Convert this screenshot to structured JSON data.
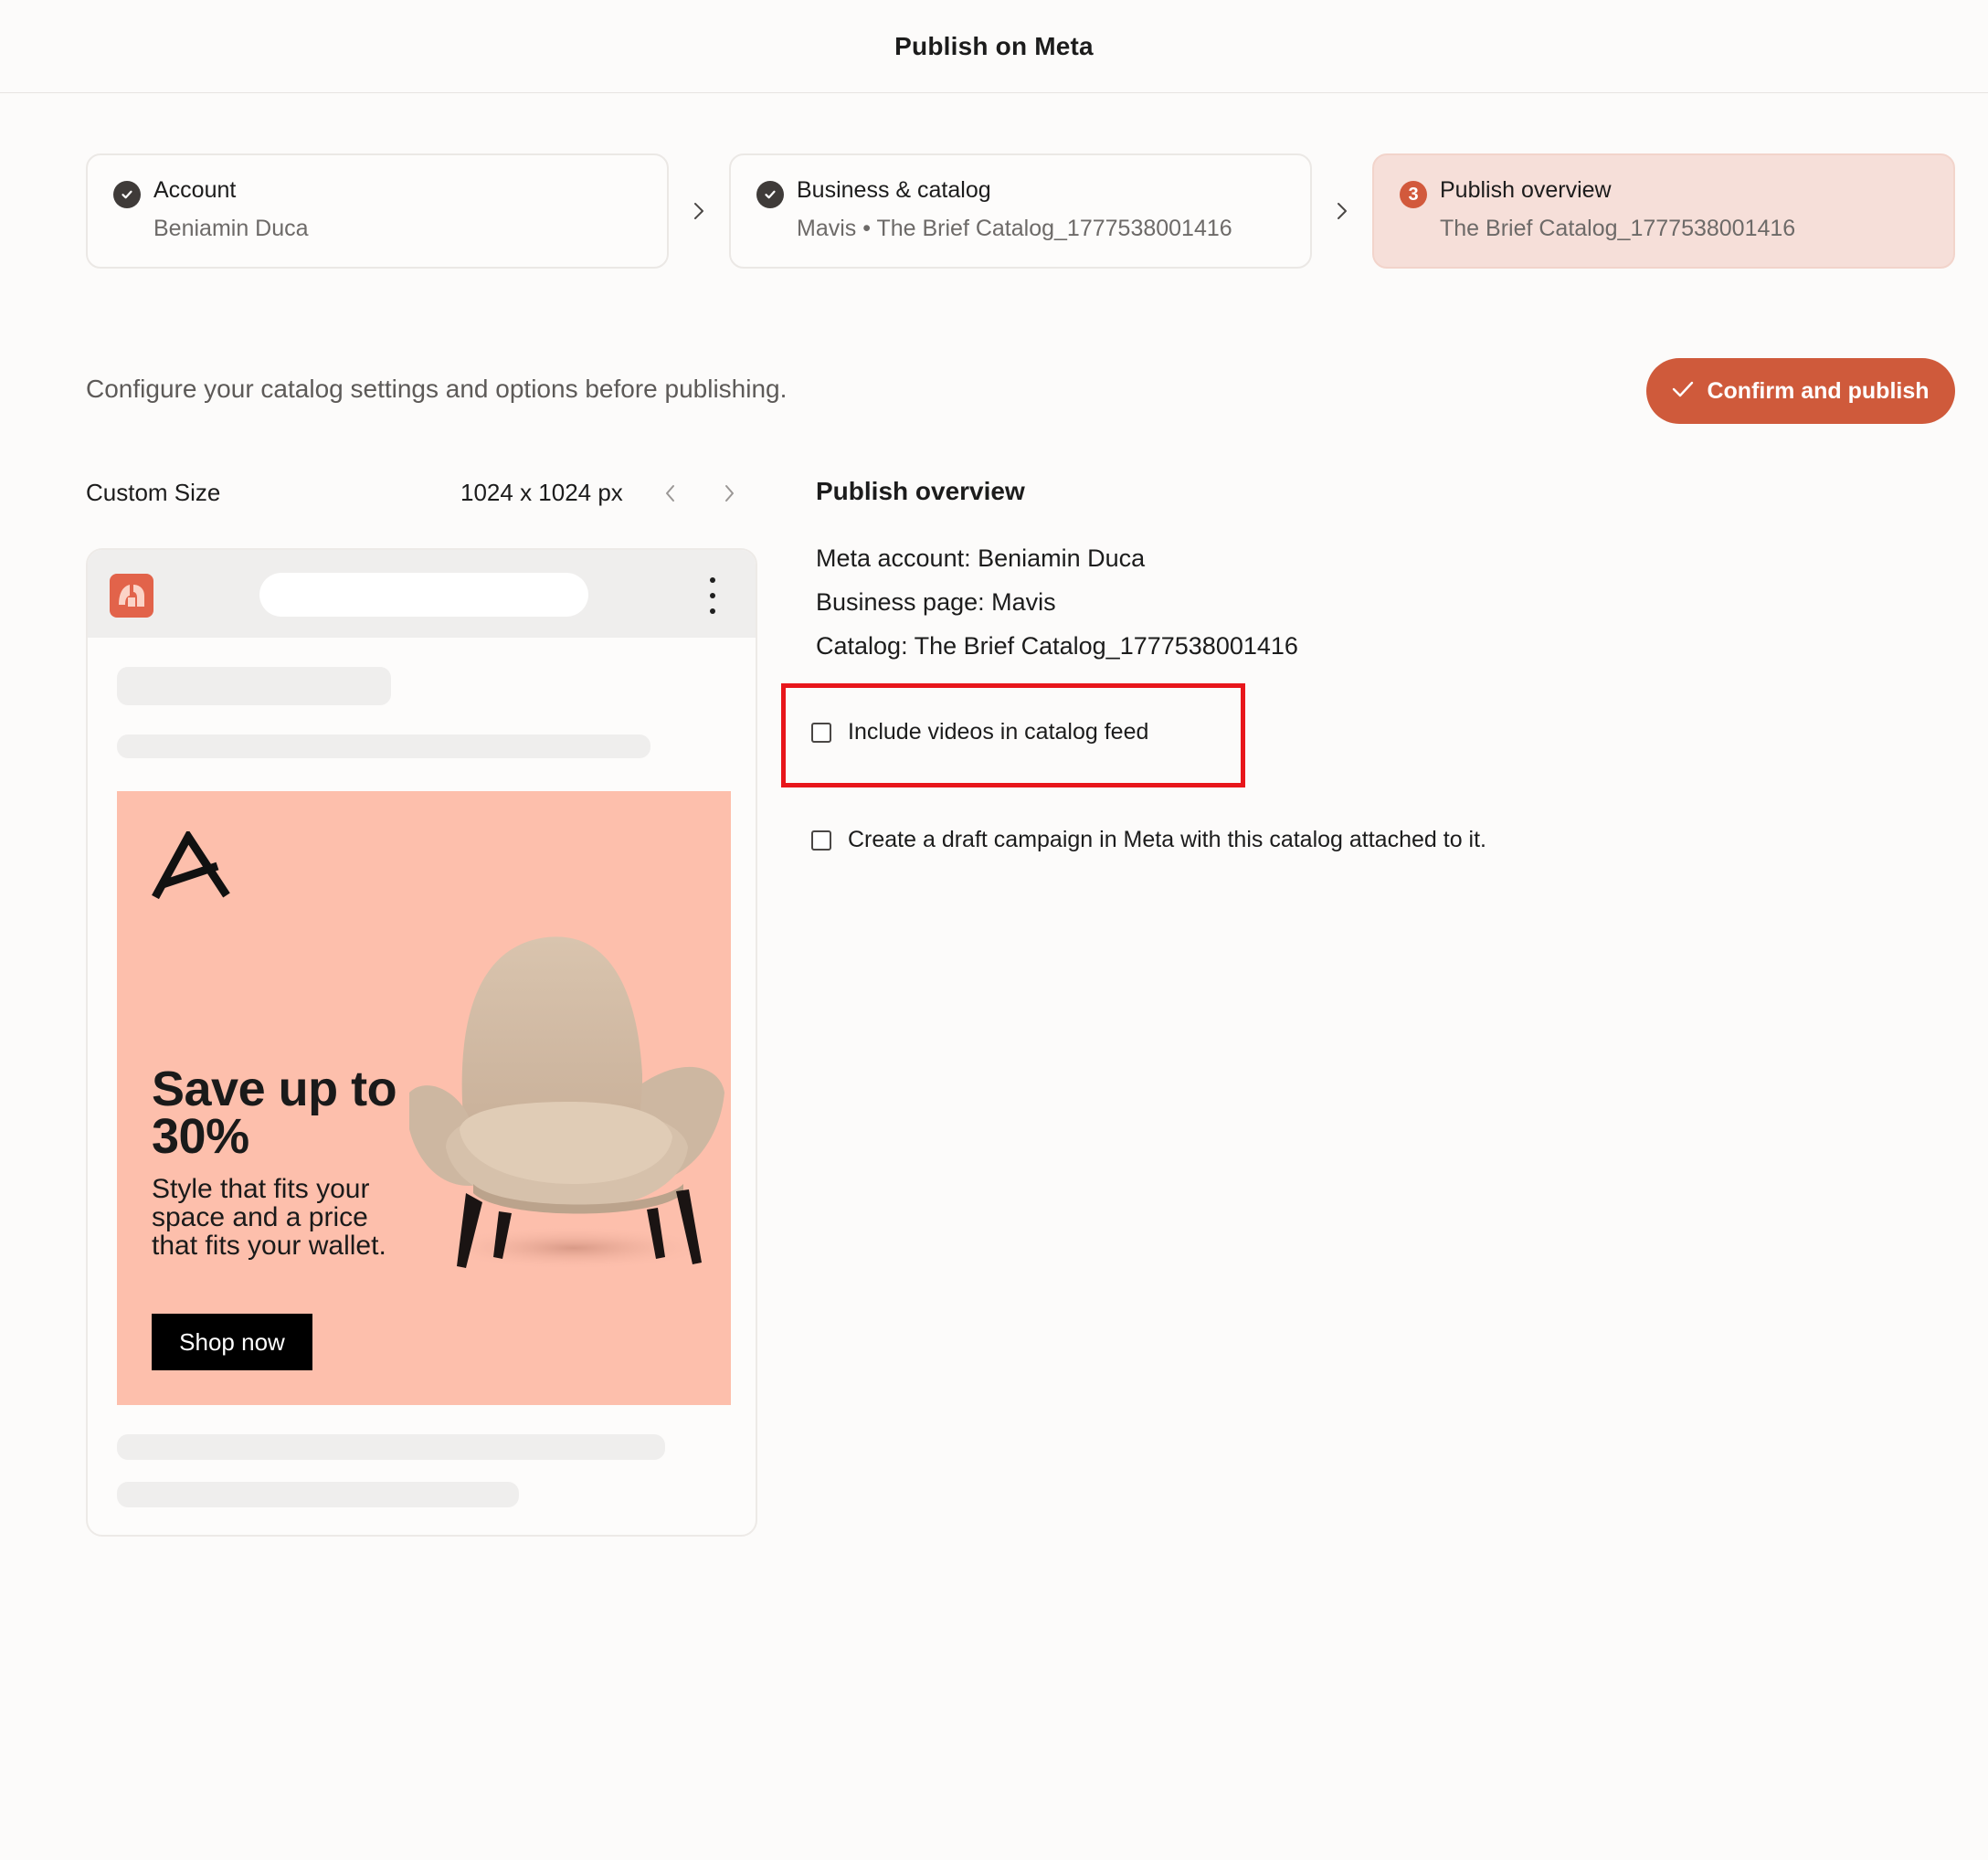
{
  "header": {
    "title": "Publish on Meta"
  },
  "stepper": {
    "steps": [
      {
        "state": "done",
        "title": "Account",
        "subtitle": "Beniamin Duca"
      },
      {
        "state": "done",
        "title": "Business & catalog",
        "subtitle": "Mavis • The Brief Catalog_1777538001416"
      },
      {
        "state": "active",
        "number": "3",
        "title": "Publish overview",
        "subtitle": "The Brief Catalog_1777538001416"
      }
    ]
  },
  "intro": "Configure your catalog settings and options before publishing.",
  "confirm_button": {
    "label": "Confirm and publish"
  },
  "preview": {
    "size_label": "Custom Size",
    "size_value": "1024 x 1024 px",
    "ad": {
      "headline": "Save up to 30%",
      "body": "Style that fits your space and a price that fits your wallet.",
      "cta": "Shop now"
    }
  },
  "overview": {
    "title": "Publish overview",
    "meta_account": "Meta account: Beniamin Duca",
    "business_page": "Business page: Mavis",
    "catalog": "Catalog: The Brief Catalog_1777538001416",
    "options": [
      {
        "label": "Include videos in catalog feed",
        "checked": false
      },
      {
        "label": "Create a draft campaign in Meta with this catalog attached to it.",
        "checked": false
      }
    ]
  },
  "colors": {
    "accent": "#cf5a3b",
    "active_step_bg": "#f6dfd9",
    "ad_bg": "#fdbfac",
    "highlight": "#e8161b"
  }
}
